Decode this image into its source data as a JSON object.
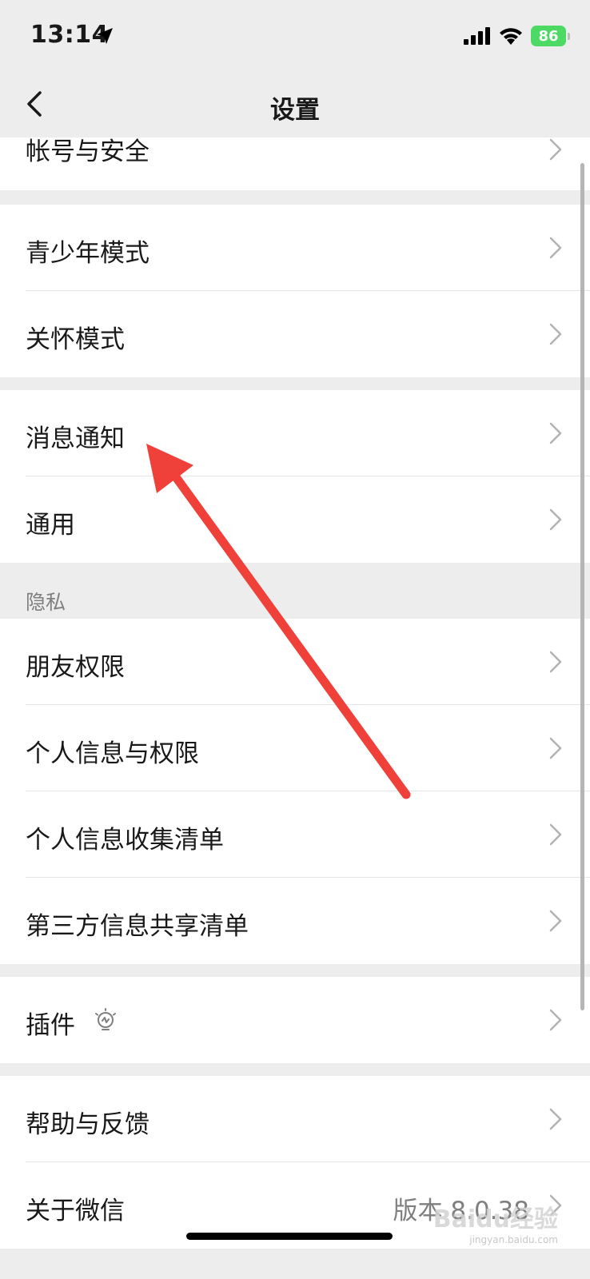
{
  "status_bar": {
    "time": "13:14",
    "battery": "86"
  },
  "nav": {
    "title": "设置"
  },
  "settings": {
    "account_security": "帐号与安全",
    "teen_mode": "青少年模式",
    "care_mode": "关怀模式",
    "notifications": "消息通知",
    "general": "通用",
    "privacy_header": "隐私",
    "friend_permissions": "朋友权限",
    "personal_info_permissions": "个人信息与权限",
    "personal_info_collection": "个人信息收集清单",
    "third_party_sharing": "第三方信息共享清单",
    "plugins": "插件",
    "help_feedback": "帮助与反馈",
    "about_wechat": "关于微信",
    "version": "版本 8.0.38"
  },
  "watermark": {
    "brand": "Baidu经验",
    "url": "jingyan.baidu.com"
  },
  "colors": {
    "page_bg": "#ededed",
    "cell_bg": "#ffffff",
    "annotation_arrow": "#f0403a",
    "battery": "#4cd964"
  }
}
